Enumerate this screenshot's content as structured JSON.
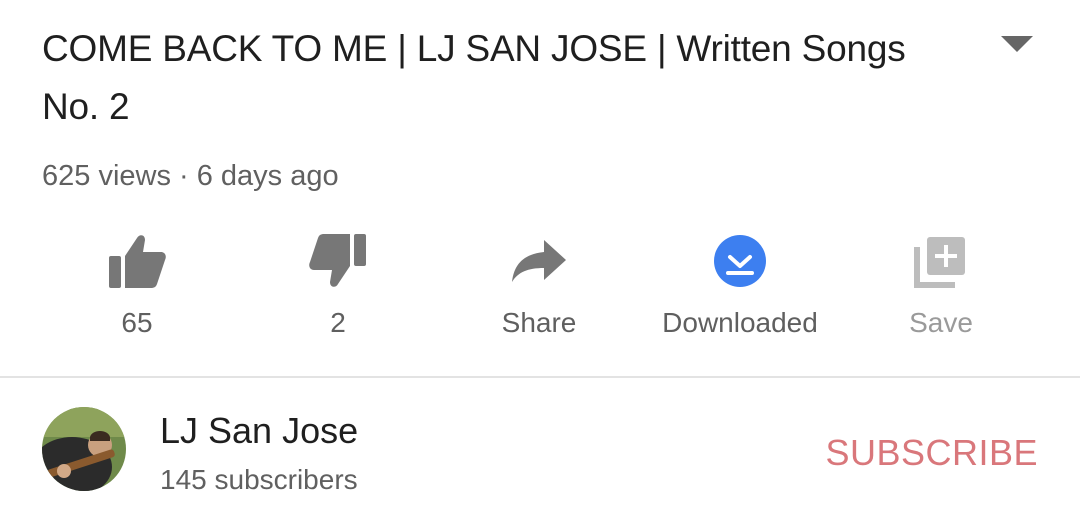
{
  "video": {
    "title": "COME BACK TO ME | LJ SAN JOSE | Written Songs No. 2",
    "meta": "625 views · 6 days ago"
  },
  "actions": {
    "like": {
      "label": "65",
      "icon": "thumbs-up-icon"
    },
    "dislike": {
      "label": "2",
      "icon": "thumbs-down-icon"
    },
    "share": {
      "label": "Share",
      "icon": "share-arrow-icon"
    },
    "download": {
      "label": "Downloaded",
      "icon": "download-check-icon",
      "color": "#3d7ff0"
    },
    "save": {
      "label": "Save",
      "icon": "add-to-playlist-icon"
    }
  },
  "channel": {
    "name": "LJ San Jose",
    "subscribers": "145 subscribers",
    "subscribe_label": "SUBSCRIBE",
    "subscribe_color": "#d9777b"
  }
}
